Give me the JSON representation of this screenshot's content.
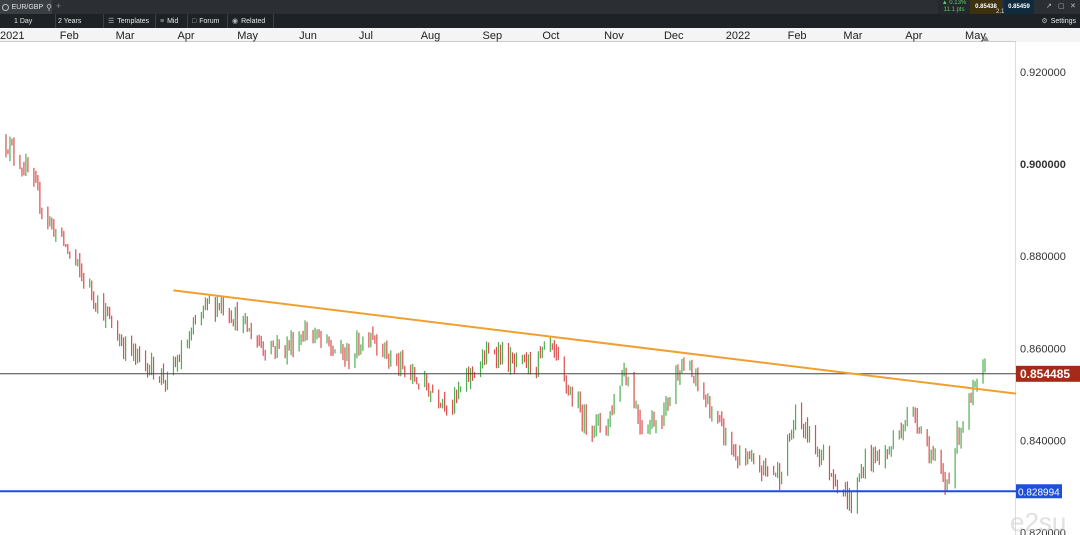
{
  "header": {
    "symbol": "EUR/GBP",
    "icons": {
      "symbol": "currency-icon",
      "search": "search-icon",
      "add": "plus-icon"
    },
    "change_pct": "▲ 0.13%",
    "change_pts": "11.1 pts",
    "bid": "0.85438",
    "ask": "0.85459",
    "spread": "2.1"
  },
  "toolbar": {
    "interval": "1 Day",
    "range": "2 Years",
    "templates": "Templates",
    "mid": "Mid",
    "forum": "Forum",
    "related": "Related",
    "settings": "Settings"
  },
  "chart_data": {
    "type": "candlestick",
    "instrument": "EUR/GBP",
    "x_labels": [
      "2021",
      "Feb",
      "Mar",
      "Apr",
      "May",
      "Jun",
      "Jul",
      "Aug",
      "Sep",
      "Oct",
      "Nov",
      "Dec",
      "2022",
      "Feb",
      "Mar",
      "Apr",
      "May"
    ],
    "y_ticks": [
      "0.920000",
      "0.900000",
      "0.880000",
      "0.860000",
      "0.840000",
      "0.820000"
    ],
    "y_major": "0.900000",
    "ylim": [
      0.8195,
      0.9265
    ],
    "x_range": [
      "2021-01-01",
      "2022-05-10"
    ],
    "current_price": "0.854485",
    "support_level": "0.828994",
    "trendline": {
      "start": {
        "date": "2021-03-29",
        "value": 0.8726
      },
      "end": {
        "date": "2022-05-10",
        "value": 0.851
      }
    },
    "colors": {
      "up": "#4caf50",
      "down": "#d94f4f",
      "trendline": "#f0a030",
      "support": "#1f4fd8",
      "current_line": "#444444",
      "current_badge": "#a52a1a",
      "support_badge": "#1f4fd8"
    },
    "grid": false,
    "watermark": "e2su",
    "ohlc_path": [
      [
        "2021-01-04",
        0.905
      ],
      [
        "2021-01-15",
        0.898
      ],
      [
        "2021-01-25",
        0.888
      ],
      [
        "2021-02-03",
        0.882
      ],
      [
        "2021-02-12",
        0.875
      ],
      [
        "2021-02-22",
        0.868
      ],
      [
        "2021-03-02",
        0.862
      ],
      [
        "2021-03-10",
        0.858
      ],
      [
        "2021-03-18",
        0.856
      ],
      [
        "2021-03-26",
        0.853
      ],
      [
        "2021-04-06",
        0.862
      ],
      [
        "2021-04-14",
        0.869
      ],
      [
        "2021-04-22",
        0.87
      ],
      [
        "2021-05-03",
        0.865
      ],
      [
        "2021-05-12",
        0.861
      ],
      [
        "2021-05-24",
        0.86
      ],
      [
        "2021-06-04",
        0.864
      ],
      [
        "2021-06-15",
        0.86
      ],
      [
        "2021-06-25",
        0.858
      ],
      [
        "2021-07-06",
        0.864
      ],
      [
        "2021-07-15",
        0.858
      ],
      [
        "2021-07-26",
        0.854
      ],
      [
        "2021-08-05",
        0.851
      ],
      [
        "2021-08-16",
        0.848
      ],
      [
        "2021-08-26",
        0.855
      ],
      [
        "2021-09-06",
        0.86
      ],
      [
        "2021-09-16",
        0.856
      ],
      [
        "2021-09-27",
        0.857
      ],
      [
        "2021-10-04",
        0.86
      ],
      [
        "2021-10-14",
        0.85
      ],
      [
        "2021-10-22",
        0.844
      ],
      [
        "2021-11-01",
        0.843
      ],
      [
        "2021-11-10",
        0.856
      ],
      [
        "2021-11-19",
        0.843
      ],
      [
        "2021-11-30",
        0.846
      ],
      [
        "2021-12-08",
        0.857
      ],
      [
        "2021-12-17",
        0.852
      ],
      [
        "2021-12-28",
        0.843
      ],
      [
        "2022-01-06",
        0.836
      ],
      [
        "2022-01-17",
        0.834
      ],
      [
        "2022-01-27",
        0.833
      ],
      [
        "2022-02-04",
        0.845
      ],
      [
        "2022-02-14",
        0.839
      ],
      [
        "2022-02-24",
        0.832
      ],
      [
        "2022-03-04",
        0.826
      ],
      [
        "2022-03-11",
        0.836
      ],
      [
        "2022-03-22",
        0.837
      ],
      [
        "2022-03-30",
        0.844
      ],
      [
        "2022-04-05",
        0.846
      ],
      [
        "2022-04-12",
        0.838
      ],
      [
        "2022-04-20",
        0.83
      ],
      [
        "2022-04-27",
        0.842
      ],
      [
        "2022-05-04",
        0.85
      ],
      [
        "2022-05-10",
        0.855
      ]
    ]
  }
}
